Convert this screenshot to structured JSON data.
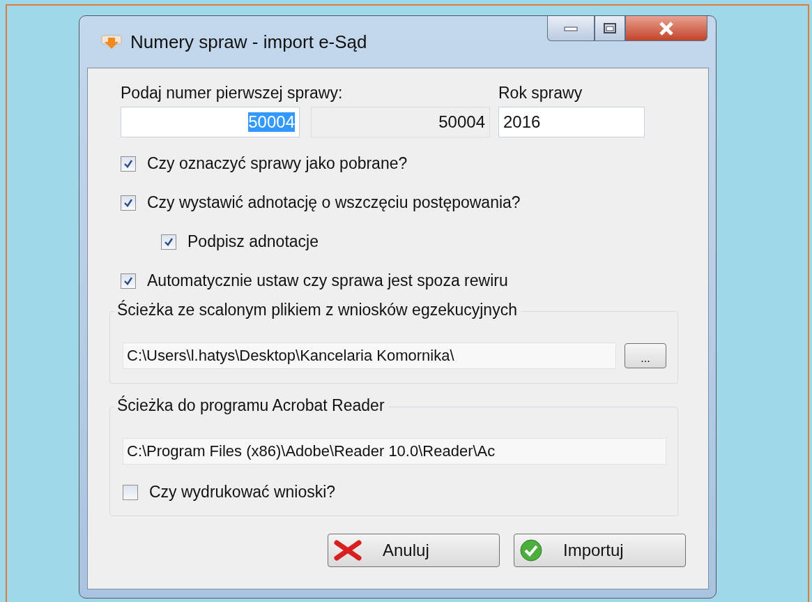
{
  "window": {
    "title": "Numery spraw - import e-Sąd"
  },
  "case_number": {
    "label": "Podaj numer pierwszej sprawy:",
    "fields": [
      {
        "value": "50004",
        "disabled": false,
        "text_selected": true
      },
      {
        "value": "50004",
        "disabled": true,
        "text_selected": false
      }
    ]
  },
  "case_year": {
    "label": "Rok sprawy",
    "value": "2016"
  },
  "options": [
    {
      "label": "Czy oznaczyć sprawy jako pobrane?",
      "checked": true
    },
    {
      "label": "Czy wystawić adnotację o wszczęciu postępowania?",
      "checked": true,
      "children": [
        {
          "label": "Podpisz adnotacje",
          "checked": true
        }
      ]
    },
    {
      "label": "Automatycznie ustaw czy sprawa jest spoza rewiru",
      "checked": true
    }
  ],
  "groups": [
    {
      "title": "Ścieżka ze scalonym plikiem z wniosków egzekucyjnych",
      "path": "C:\\Users\\l.hatys\\Desktop\\Kancelaria Komornika\\",
      "browse_button": "..."
    },
    {
      "title": "Ścieżka do programu Acrobat Reader",
      "path": "C:\\Program Files (x86)\\Adobe\\Reader 10.0\\Reader\\Ac",
      "options": [
        {
          "label": "Czy wydrukować wnioski?",
          "checked": false
        }
      ]
    }
  ],
  "buttons": [
    {
      "label": "Anuluj",
      "kind": "cancel"
    },
    {
      "label": "Importuj",
      "kind": "ok"
    }
  ]
}
